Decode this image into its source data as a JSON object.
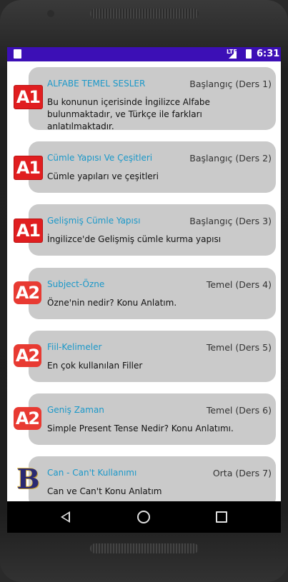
{
  "status_bar": {
    "network": "LTE",
    "time": "6:31"
  },
  "lessons": [
    {
      "badge": "A1",
      "badge_style": "a1",
      "title": "ALFABE TEMEL SESLER",
      "level": "Başlangıç (Ders 1)",
      "desc": "Bu konunun içerisinde İngilizce Alfabe bulunmaktadır, ve Türkçe ile farkları anlatılmaktadır."
    },
    {
      "badge": "A1",
      "badge_style": "a1",
      "title": "Cümle Yapısı Ve Çeşitleri",
      "level": "Başlangıç (Ders 2)",
      "desc": "Cümle yapıları ve çeşitleri"
    },
    {
      "badge": "A1",
      "badge_style": "a1",
      "title": "Gelişmiş Cümle Yapısı",
      "level": "Başlangıç (Ders 3)",
      "desc": "İngilizce'de Gelişmiş cümle kurma yapısı"
    },
    {
      "badge": "A2",
      "badge_style": "a2",
      "title": "Subject-Özne",
      "level": "Temel (Ders 4)",
      "desc": "Özne'nin nedir? Konu Anlatım."
    },
    {
      "badge": "A2",
      "badge_style": "a2",
      "title": "Fiil-Kelimeler",
      "level": "Temel (Ders 5)",
      "desc": "En çok kullanılan Filler"
    },
    {
      "badge": "A2",
      "badge_style": "a2",
      "title": "Geniş Zaman",
      "level": "Temel (Ders 6)",
      "desc": "Simple Present Tense Nedir? Konu Anlatımı."
    },
    {
      "badge": "B",
      "badge_style": "b",
      "title": "Can - Can't Kullanımı",
      "level": "Orta (Ders 7)",
      "desc": "Can ve Can't  Konu Anlatım"
    }
  ],
  "nav": {
    "back": "back-icon",
    "home": "home-icon",
    "recents": "recents-icon"
  }
}
